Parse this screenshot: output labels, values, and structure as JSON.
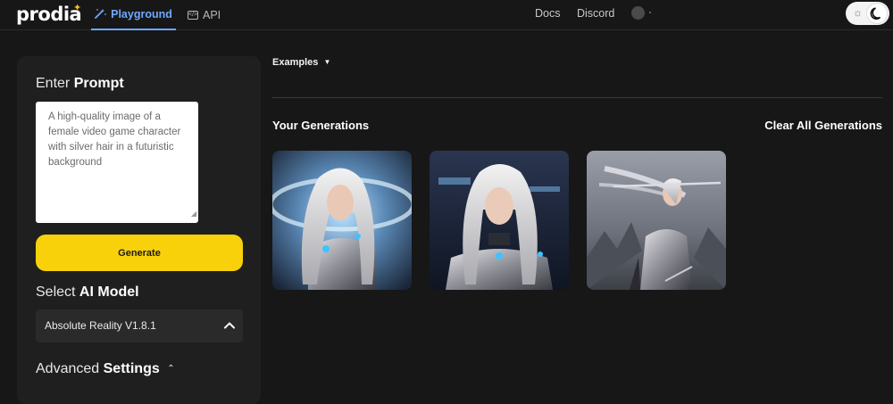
{
  "brand": {
    "name": "prodia"
  },
  "nav": {
    "tabs": [
      {
        "label": "Playground",
        "active": true
      },
      {
        "label": "API",
        "active": false
      }
    ],
    "links": [
      "Docs",
      "Discord"
    ]
  },
  "prompt": {
    "title_prefix": "Enter",
    "title_bold": "Prompt",
    "text": "A high-quality image of a female video game character with silver hair in a futuristic background",
    "generate_label": "Generate"
  },
  "model": {
    "title_prefix": "Select",
    "title_bold": "AI Model",
    "selected": "Absolute Reality V1.8.1"
  },
  "advanced": {
    "title_prefix": "Advanced",
    "title_bold": "Settings"
  },
  "main": {
    "examples_label": "Examples",
    "generations_title": "Your Generations",
    "clear_label": "Clear All Generations",
    "images": [
      "generated-image-1",
      "generated-image-2",
      "generated-image-3"
    ]
  },
  "colors": {
    "accent_blue": "#6fa8ff",
    "generate_yellow": "#f9d10a",
    "background": "#171717",
    "panel": "#1f1f1f"
  }
}
